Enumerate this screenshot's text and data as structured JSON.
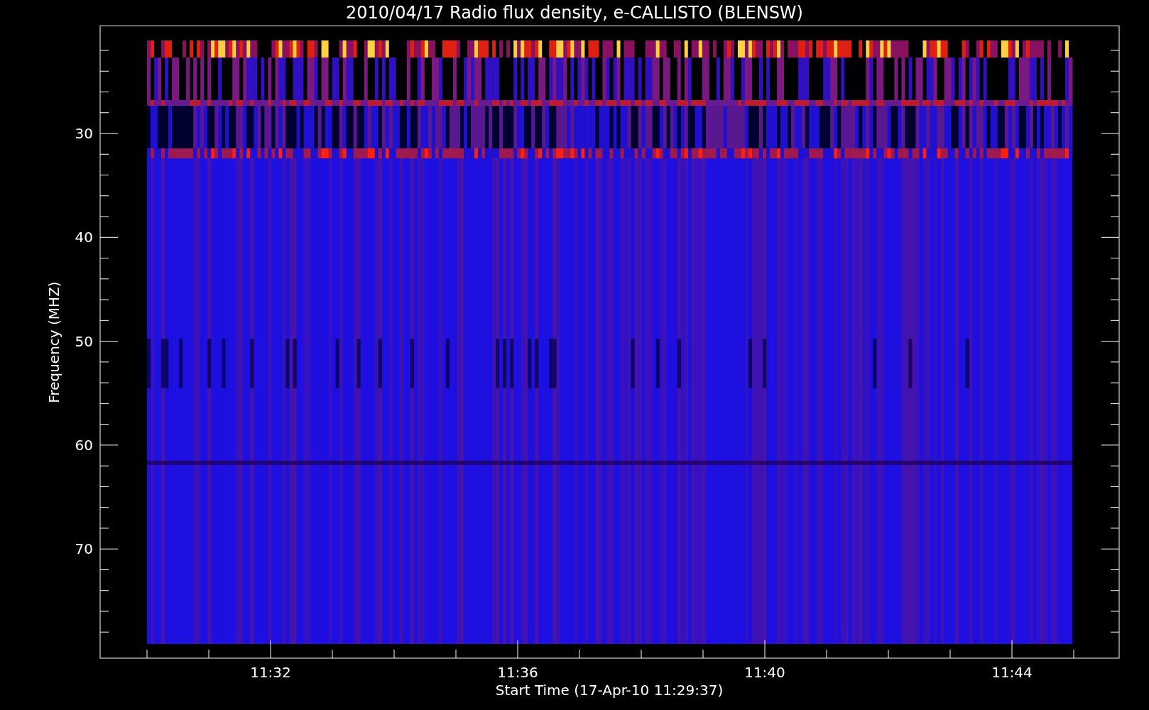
{
  "title": "2010/04/17  Radio flux density, e-CALLISTO (BLENSW)",
  "y_axis": {
    "label": "Frequency (MHZ)",
    "ticks": [
      "30",
      "40",
      "50",
      "60",
      "70"
    ]
  },
  "x_axis": {
    "label": "Start Time (17-Apr-10 11:29:37)",
    "ticks": [
      "11:32",
      "11:36",
      "11:40",
      "11:44"
    ]
  }
}
